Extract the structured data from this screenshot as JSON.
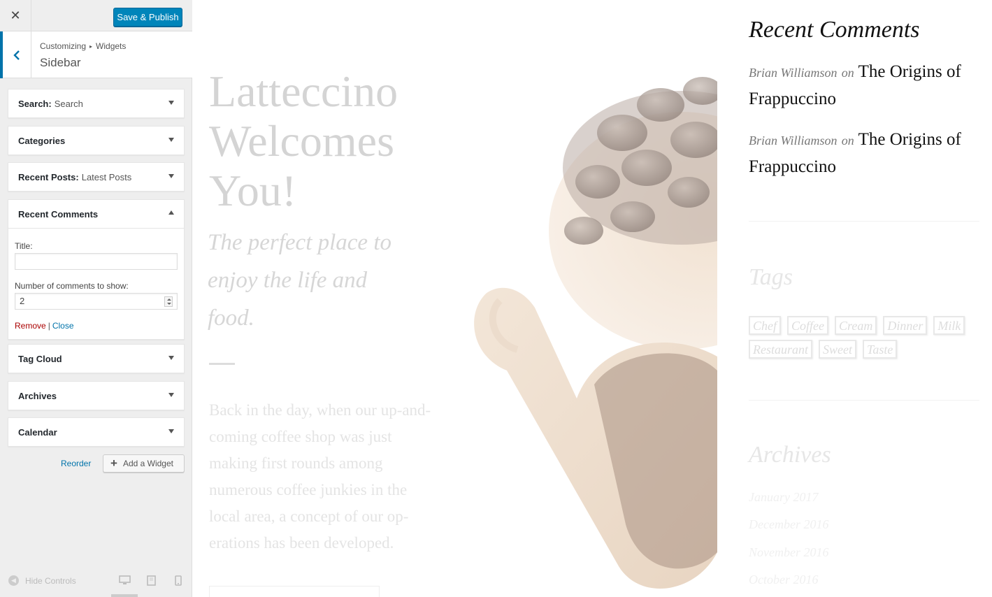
{
  "customizer": {
    "close_label": "✕",
    "save_label": "Save & Publish",
    "breadcrumb": [
      "Customizing",
      "Widgets"
    ],
    "breadcrumb_sep": "▸",
    "section_title": "Sidebar",
    "widgets": [
      {
        "name": "Search",
        "instance": "Search"
      },
      {
        "name": "Categories",
        "instance": ""
      },
      {
        "name": "Recent Posts",
        "instance": "Latest Posts"
      },
      {
        "name": "Recent Comments",
        "instance": "",
        "expanded": true
      },
      {
        "name": "Tag Cloud",
        "instance": ""
      },
      {
        "name": "Archives",
        "instance": ""
      },
      {
        "name": "Calendar",
        "instance": ""
      }
    ],
    "widget_colon": ":",
    "recent_comments_form": {
      "title_label": "Title:",
      "title_value": "",
      "count_label": "Number of comments to show:",
      "count_value": "2",
      "remove_label": "Remove",
      "separator": "|",
      "close_label": "Close"
    },
    "reorder_label": "Reorder",
    "add_widget_label": "Add a Widget",
    "hide_controls_label": "Hide Controls"
  },
  "preview": {
    "hero_title": "Latteccino Welcomes You!",
    "hero_subtitle": "The perfect place to enjoy the life and food.",
    "hero_body": "Back in the day, when our up-and-coming coffee shop was just making first rounds among numerous coffee junkies in the local area, a concept of our op-erations has been developed.",
    "sidebar": {
      "recent_comments_heading": "Recent Comments",
      "comments": [
        {
          "author": "Brian Williamson",
          "on": "on",
          "post": "The Origins of Frappuccino"
        },
        {
          "author": "Brian Williamson",
          "on": "on",
          "post": "The Origins of Frappuccino"
        }
      ],
      "tags_heading": "Tags",
      "tags": [
        "Chef",
        "Coffee",
        "Cream",
        "Dinner",
        "Milk",
        "Restaurant",
        "Sweet",
        "Taste"
      ],
      "archives_heading": "Archives",
      "archives": [
        "January 2017",
        "December 2016",
        "November 2016",
        "October 2016"
      ]
    }
  },
  "colors": {
    "accent": "#0085ba",
    "link": "#0073aa",
    "remove": "#a00000"
  }
}
